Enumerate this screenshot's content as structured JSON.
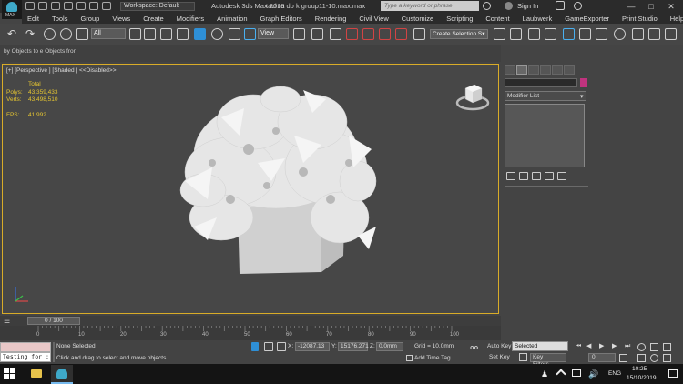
{
  "titlebar": {
    "app_logo_text": "MAX",
    "workspace": "Workspace: Default",
    "app_title": "Autodesk 3ds Max 2016",
    "file_title": "tach a do k group11-10.max.max",
    "search_placeholder": "Type a keyword or phrase",
    "sign_in": "Sign In",
    "window_controls": [
      "—",
      "□",
      "✕"
    ]
  },
  "menubar": {
    "items": [
      "Edit",
      "Tools",
      "Group",
      "Views",
      "Create",
      "Modifiers",
      "Animation",
      "Graph Editors",
      "Rendering",
      "Civil View",
      "Customize",
      "Scripting",
      "Content",
      "Laubwerk",
      "GameExporter",
      "Print Studio",
      "Help"
    ]
  },
  "toolbar": {
    "filter_dropdown": "All",
    "ref_coord_dropdown": "View",
    "selection_set": "Create Selection S▾"
  },
  "ribbon": {
    "tab_text": "by Objects to  e Objects fron"
  },
  "viewport": {
    "label": "[+] [Perspective ] [Shaded ] <<Disabled>>",
    "stats": {
      "total_label": "Total",
      "polys_label": "Polys:",
      "polys_value": "43,359,433",
      "verts_label": "Verts:",
      "verts_value": "43,498,510",
      "fps_label": "FPS:",
      "fps_value": "41.992"
    },
    "border_color": "#d9ac28"
  },
  "command_panel": {
    "modifier_list": "Modifier List",
    "object_color": "#c0337e"
  },
  "timeline": {
    "slider_label": "0 / 100",
    "ticks": [
      "0",
      "10",
      "20",
      "30",
      "40",
      "50",
      "60",
      "70",
      "80",
      "90",
      "100"
    ]
  },
  "statusbar": {
    "maxscript_text": "Testing for :",
    "selection_status": "None Selected",
    "prompt": "Click and drag to select and move objects",
    "x_label": "X:",
    "x_value": "-12087.13",
    "y_label": "Y:",
    "y_value": "15176.271",
    "z_label": "Z:",
    "z_value": "0.0mm",
    "grid": "Grid = 10.0mm",
    "add_time_tag": "Add Time Tag",
    "auto_key": "Auto Key",
    "set_key": "Set Key",
    "auto_key_mode": "Selected",
    "key_filters": "Key Filters...",
    "frame": "0"
  },
  "taskbar": {
    "language": "ENG",
    "time": "10:25",
    "date": "15/10/2019"
  }
}
